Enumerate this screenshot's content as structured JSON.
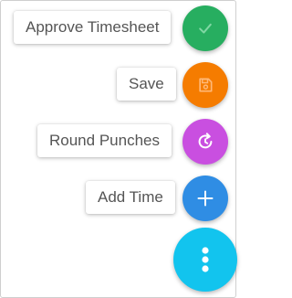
{
  "actions": [
    {
      "label": "Approve Timesheet",
      "icon": "check-icon",
      "color": "#27ae60"
    },
    {
      "label": "Save",
      "icon": "save-icon",
      "color": "#f57c00"
    },
    {
      "label": "Round Punches",
      "icon": "round-punches-icon",
      "color": "#c94fe0"
    },
    {
      "label": "Add Time",
      "icon": "plus-icon",
      "color": "#2f8de4"
    }
  ],
  "main_fab": {
    "icon": "more-vertical-icon",
    "color": "#12c4ee"
  }
}
